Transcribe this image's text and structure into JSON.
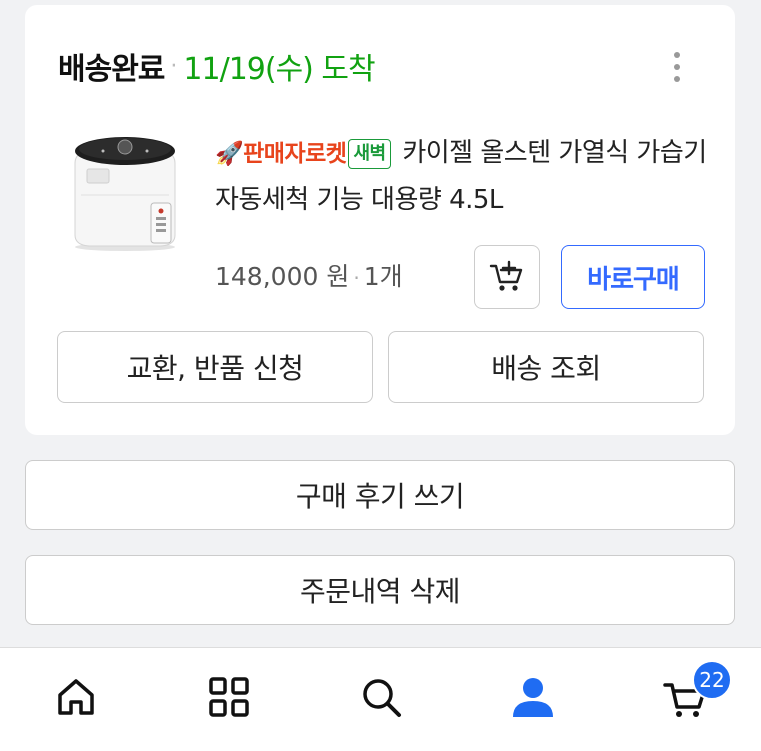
{
  "order": {
    "status": "배송완료",
    "separator": "·",
    "arrival": "11/19(수) 도착",
    "product": {
      "badge_rocket": "🚀판매자로켓",
      "badge_dawn": "새벽",
      "title": "카이젤 올스텐 가열식 가습기 자동세척 기능 대용량 4.5L",
      "price": "148,000 원",
      "qty": "1개",
      "image_icon": "humidifier-product-image"
    },
    "buy_now_label": "바로구매",
    "exchange_label": "교환, 반품 신청",
    "tracking_label": "배송 조회"
  },
  "review_label": "구매 후기 쓰기",
  "delete_label": "주문내역 삭제",
  "nav": {
    "items": [
      "home-icon",
      "category-icon",
      "search-icon",
      "my-account-icon",
      "cart-icon"
    ],
    "cart_count": "22",
    "active_color": "#1f6cf2"
  },
  "colors": {
    "status_date": "#11a211",
    "buy_now": "#346aff",
    "rocket": "#e8441c",
    "dawn": "#1a9a3a"
  }
}
